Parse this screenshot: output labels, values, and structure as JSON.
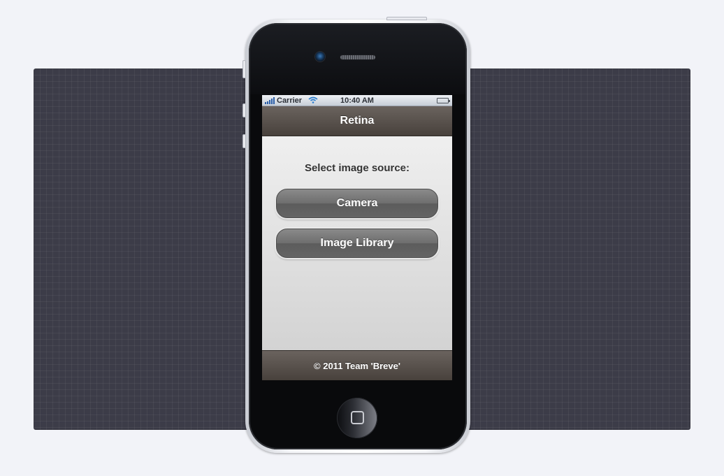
{
  "status_bar": {
    "carrier": "Carrier",
    "time": "10:40 AM",
    "icons": [
      "signal-icon",
      "wifi-icon",
      "battery-icon"
    ]
  },
  "header": {
    "title": "Retina"
  },
  "main": {
    "prompt": "Select image source:",
    "buttons": [
      {
        "label": "Camera"
      },
      {
        "label": "Image Library"
      }
    ]
  },
  "footer": {
    "text": "© 2011 Team 'Breve'"
  },
  "colors": {
    "bar_brown": "#5a534e",
    "button_gray": "#6e6e6e",
    "backdrop": "#3c3c48"
  }
}
